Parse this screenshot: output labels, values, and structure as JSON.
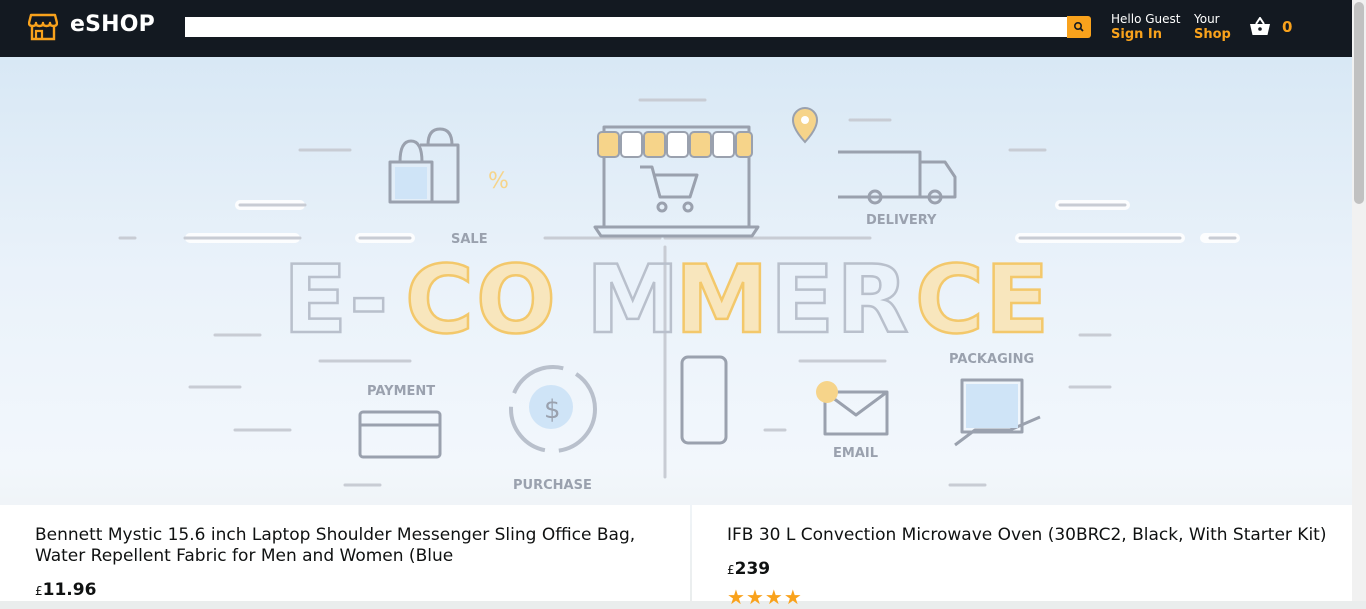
{
  "header": {
    "brand": "eSHOP",
    "search": {
      "placeholder": "",
      "value": ""
    },
    "account": {
      "greeting": "Hello Guest",
      "action": "Sign In"
    },
    "shop": {
      "line1": "Your",
      "line2": "Shop"
    },
    "cart": {
      "count": "0"
    }
  },
  "banner": {
    "headline": "E-COMMERCE",
    "labels": [
      "SALE",
      "DELIVERY",
      "PAYMENT",
      "PACKAGING",
      "PURCHASE",
      "EMAIL"
    ]
  },
  "products": [
    {
      "title": "Bennett Mystic 15.6 inch Laptop Shoulder Messenger Sling Office Bag, Water Repellent Fabric for Men and Women (Blue",
      "currency": "£",
      "price": "11.96"
    },
    {
      "title": "IFB 30 L Convection Microwave Oven (30BRC2, Black, With Starter Kit)",
      "currency": "£",
      "price": "239",
      "rating": 4
    }
  ],
  "colors": {
    "accent": "#f9a21c",
    "topbar": "#131921",
    "text": "#0f1111"
  }
}
